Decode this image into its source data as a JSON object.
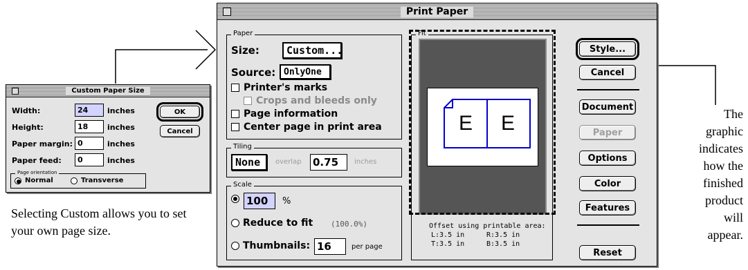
{
  "callout_left": "Selecting Custom allows you to set your own page size.",
  "callout_right": [
    "The",
    "graphic",
    "indicates",
    "how the",
    "finished",
    "product",
    "will",
    "appear."
  ],
  "custom_dialog": {
    "title": "Custom Paper Size",
    "width_label": "Width:",
    "width_value": "24",
    "height_label": "Height:",
    "height_value": "18",
    "margin_label": "Paper margin:",
    "margin_value": "0",
    "feed_label": "Paper feed:",
    "feed_value": "0",
    "unit": "inches",
    "ok_label": "OK",
    "cancel_label": "Cancel",
    "orientation_label": "Page orientation",
    "normal_label": "Normal",
    "transverse_label": "Transverse"
  },
  "print_dialog": {
    "title": "Print Paper",
    "paper_group": "Paper",
    "size_label": "Size:",
    "size_value": "Custom...",
    "source_label": "Source:",
    "source_value": "OnlyOne",
    "printers_marks": "Printer's marks",
    "crops_bleeds": "Crops and bleeds only",
    "page_info": "Page information",
    "center_page": "Center page in print area",
    "tiling_group": "Tiling",
    "tiling_value": "None",
    "overlap_label": "overlap",
    "overlap_value": "0.75",
    "overlap_unit": "inches",
    "scale_group": "Scale",
    "scale_value": "100",
    "percent": "%",
    "reduce_label": "Reduce to fit",
    "reduce_value": "(100.0%)",
    "thumbs_label": "Thumbnails:",
    "thumbs_value": "16",
    "per_page": "per page",
    "fit_group": "Fit",
    "page_letter": "E",
    "offset_title": "Offset using printable area:",
    "offset_l": "L:3.5 in",
    "offset_r": "R:3.5 in",
    "offset_t": "T:3.5 in",
    "offset_b": "B:3.5 in",
    "buttons": {
      "style": "Style...",
      "cancel": "Cancel",
      "document": "Document",
      "paper": "Paper",
      "options": "Options",
      "color": "Color",
      "features": "Features",
      "reset": "Reset"
    }
  },
  "colors": {
    "field_highlight": "#d3d3ff",
    "preview_bg": "#555555",
    "page_outline": "#0000cc"
  }
}
